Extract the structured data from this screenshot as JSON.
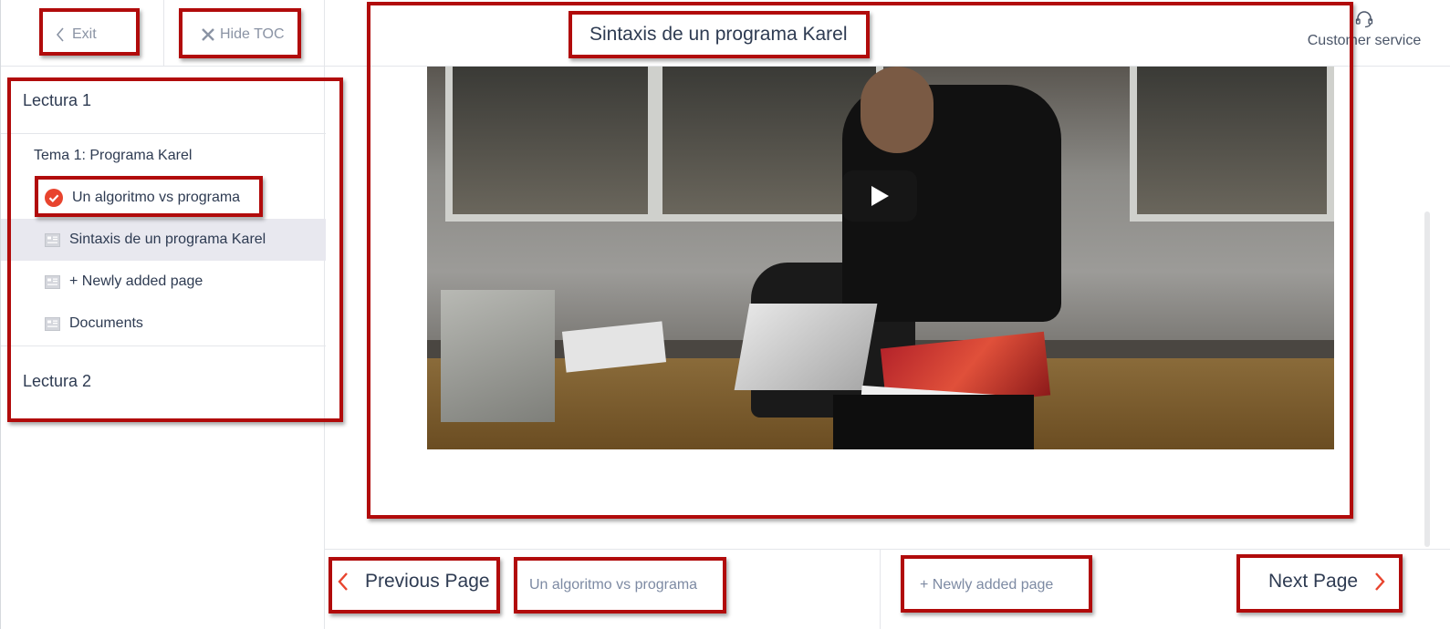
{
  "toolbar": {
    "exit_label": "Exit",
    "hide_toc_label": "Hide TOC"
  },
  "toc": {
    "sections": [
      {
        "title": "Lectura 1",
        "topic": "Tema 1: Programa Karel",
        "items": [
          {
            "label": "Un algoritmo vs programa",
            "state": "completed",
            "icon": "check-circle-icon"
          },
          {
            "label": "Sintaxis de un programa Karel",
            "state": "active",
            "icon": "page-icon"
          },
          {
            "label": "+ Newly added page",
            "state": "default",
            "icon": "page-icon"
          },
          {
            "label": "Documents",
            "state": "default",
            "icon": "page-icon"
          }
        ]
      },
      {
        "title": "Lectura 2"
      }
    ]
  },
  "header": {
    "page_title": "Sintaxis de un programa Karel",
    "customer_service": "Customer service"
  },
  "video": {
    "play_icon": "play-icon"
  },
  "footer": {
    "prev_label": "Previous Page",
    "prev_title": "Un algoritmo vs programa",
    "next_title": "+ Newly added page",
    "next_label": "Next Page"
  },
  "colors": {
    "accent": "#e8442e",
    "text": "#2e3b52",
    "muted": "#7d8aa3",
    "active_bg": "#e8e8ef",
    "annotation": "#b10b0b"
  }
}
